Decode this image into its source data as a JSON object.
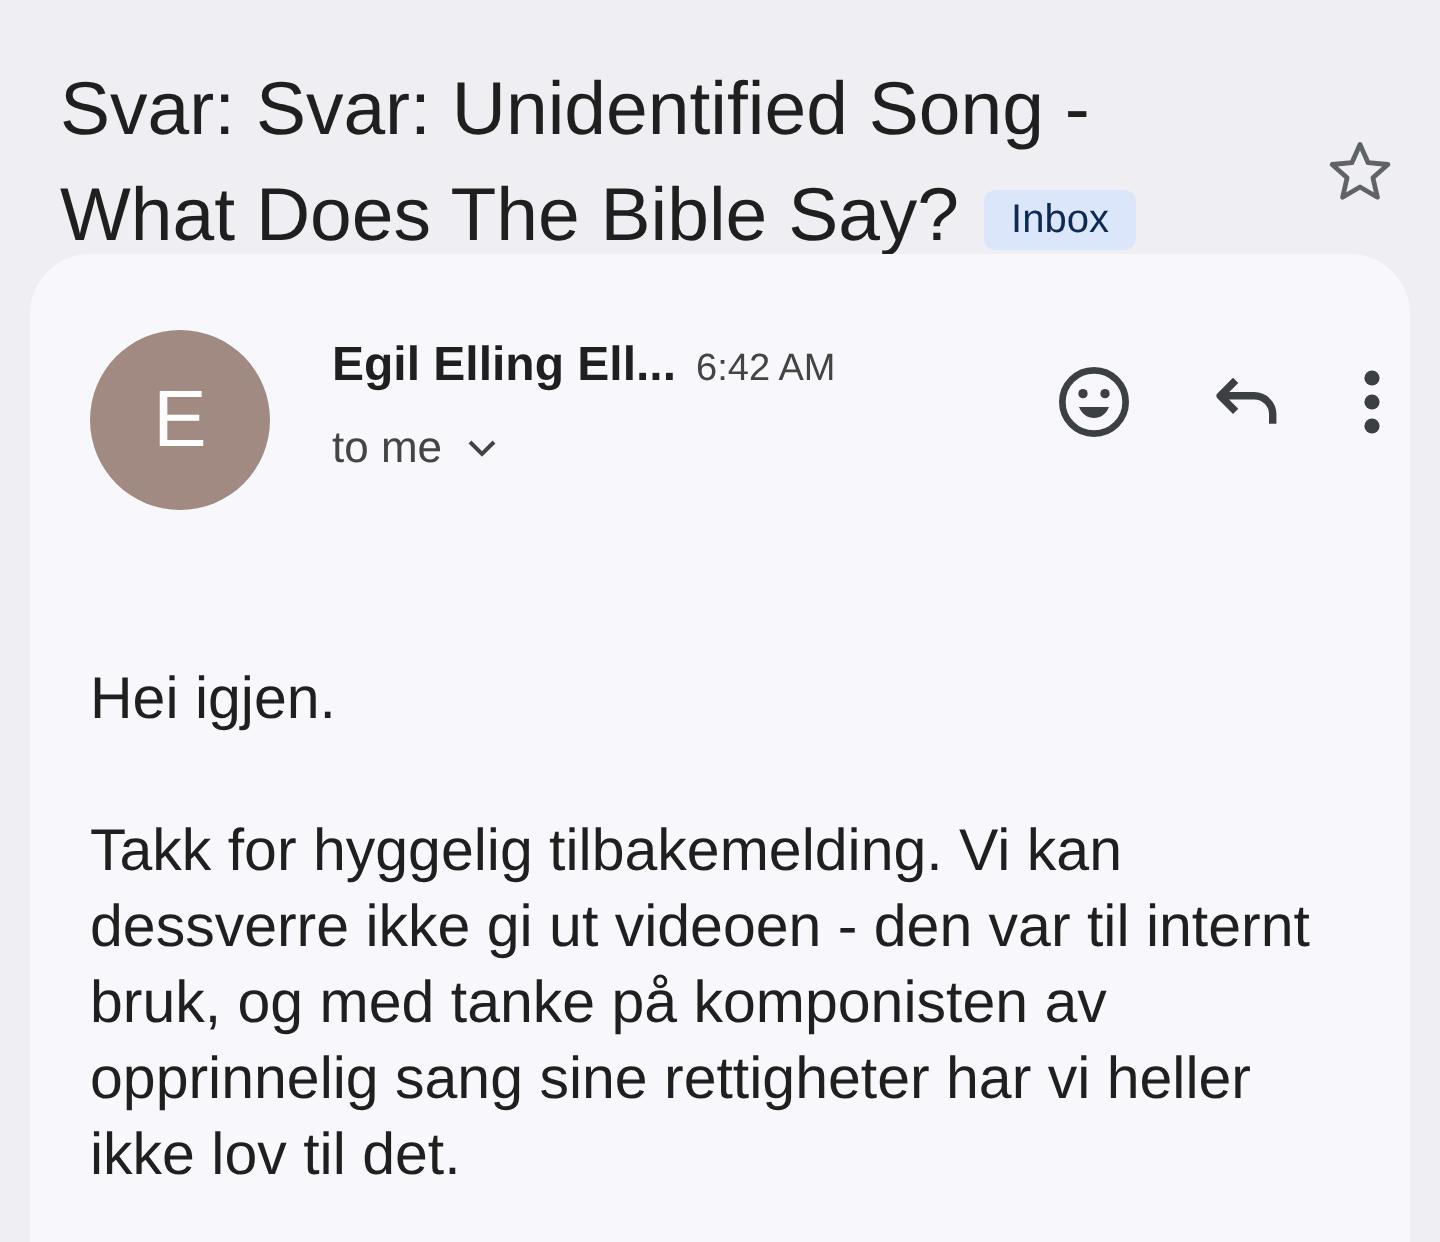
{
  "subject": "Svar: Svar: Unidentified Song - What Does The Bible Say?",
  "label": "Inbox",
  "starred": false,
  "message": {
    "avatar_letter": "E",
    "sender": "Egil Elling Ell...",
    "time": "6:42 AM",
    "recipient": "to me",
    "body": [
      "Hei igjen.",
      "Takk for hyggelig tilbakemelding. Vi kan dessverre ikke gi ut videoen - den var til internt bruk, og med tanke på komponisten av opprinnelig sang sine rettigheter har vi heller ikke lov til det."
    ]
  }
}
